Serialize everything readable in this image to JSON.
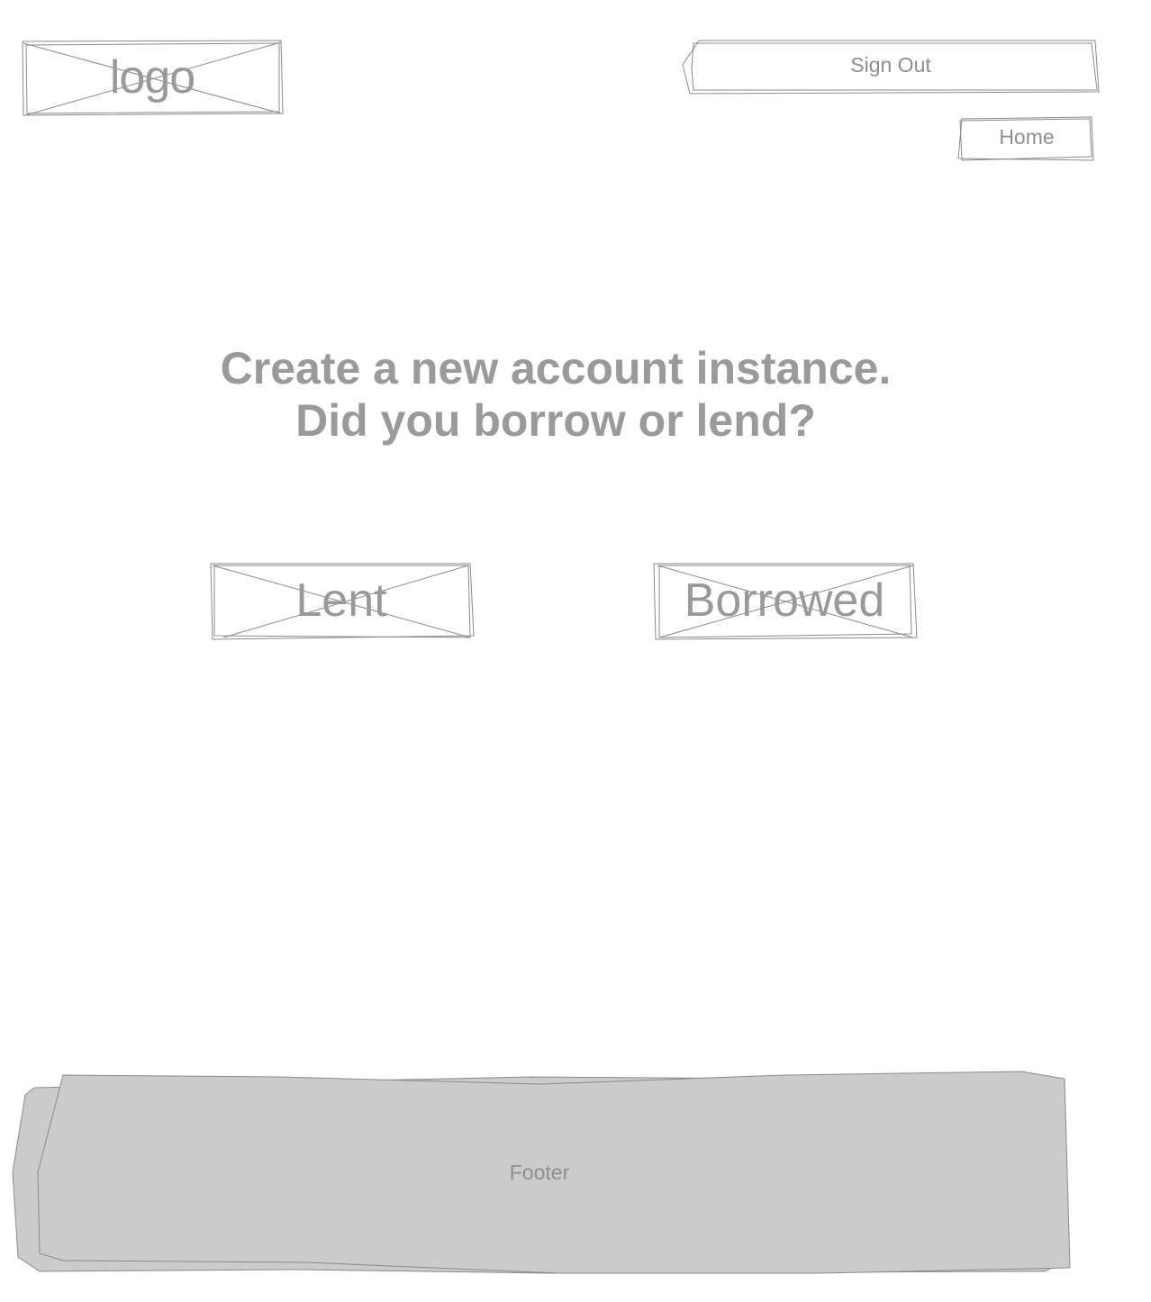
{
  "header": {
    "logo_label": "logo",
    "sign_out_label": "Sign Out",
    "home_label": "Home"
  },
  "main": {
    "heading_line1": "Create a new account instance.",
    "heading_line2": "Did you borrow or lend?",
    "lent_label": "Lent",
    "borrowed_label": "Borrowed"
  },
  "footer": {
    "label": "Footer"
  },
  "colors": {
    "text": "#999999",
    "stroke": "#8a8a8a",
    "footer_fill": "#cbcbcb"
  }
}
